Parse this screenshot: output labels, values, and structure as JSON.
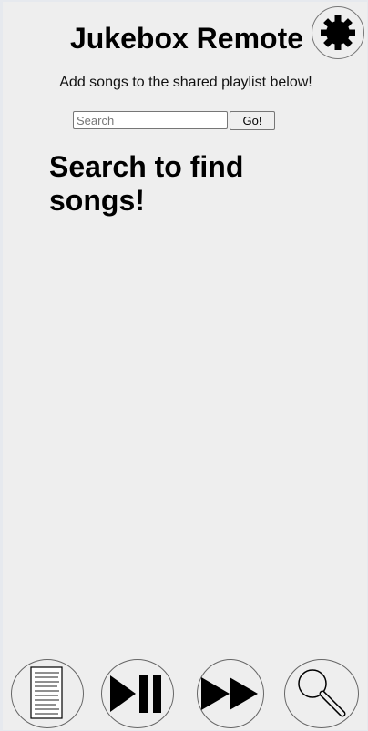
{
  "header": {
    "title": "Jukebox Remote",
    "subtitle": "Add songs to the shared playlist below!"
  },
  "search": {
    "placeholder": "Search",
    "value": "",
    "go_label": "Go!"
  },
  "results": {
    "empty_message": "Search to find songs!"
  },
  "icons": {
    "settings": "gear-icon",
    "playlist": "playlist-icon",
    "play_pause": "play-pause-icon",
    "skip": "fast-forward-icon",
    "search": "magnifying-glass-icon"
  },
  "colors": {
    "background": "#eeeeee",
    "icon": "#000000"
  }
}
